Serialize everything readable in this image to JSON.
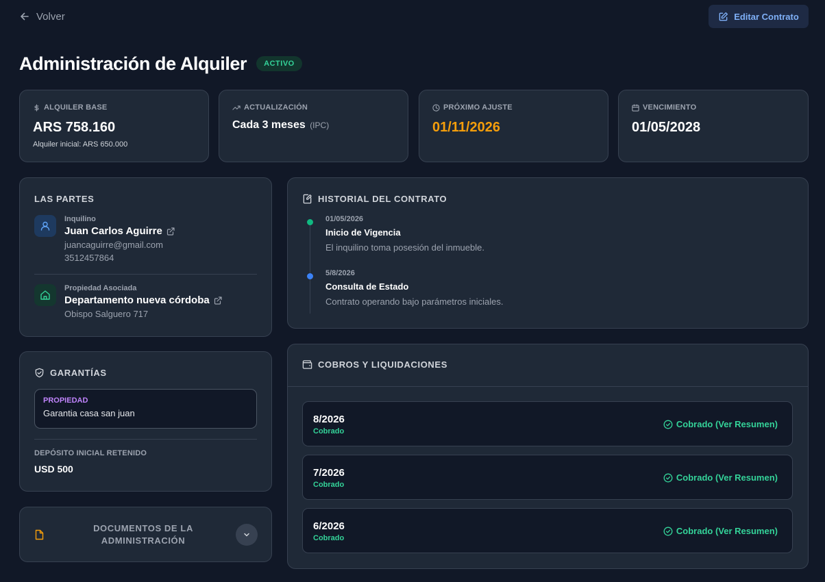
{
  "nav": {
    "back_label": "Volver",
    "edit_label": "Editar Contrato"
  },
  "header": {
    "title": "Administración de Alquiler",
    "status": "ACTIVO"
  },
  "stats": {
    "base_rent": {
      "label": "ALQUILER BASE",
      "value": "ARS 758.160",
      "note": "Alquiler inicial: ARS 650.000",
      "icon": "dollar-icon"
    },
    "update": {
      "label": "ACTUALIZACIÓN",
      "value": "Cada 3 meses",
      "value_suffix": "(IPC)",
      "icon": "trending-up-icon"
    },
    "next_adjust": {
      "label": "PRÓXIMO AJUSTE",
      "value": "01/11/2026",
      "icon": "clock-icon",
      "color": "#f59e0b"
    },
    "expiry": {
      "label": "VENCIMIENTO",
      "value": "01/05/2028",
      "icon": "calendar-icon"
    }
  },
  "parties": {
    "heading": "LAS PARTES",
    "tenant": {
      "role": "Inquilino",
      "name": "Juan Carlos Aguirre",
      "email": "juancaguirre@gmail.com",
      "phone": "3512457864"
    },
    "property": {
      "role": "Propiedad Asociada",
      "name": "Departamento nueva córdoba",
      "address": "Obispo Salguero 717"
    }
  },
  "guarantees": {
    "heading": "GARANTÍAS",
    "item": {
      "type": "PROPIEDAD",
      "description": "Garantia casa san juan"
    },
    "deposit_label": "DEPÓSITO INICIAL RETENIDO",
    "deposit_value": "USD 500"
  },
  "documents": {
    "heading_line1": "DOCUMENTOS DE LA",
    "heading_line2": "ADMINISTRACIÓN"
  },
  "history": {
    "heading": "HISTORIAL DEL CONTRATO",
    "events": [
      {
        "date": "01/05/2026",
        "title": "Inicio de Vigencia",
        "description": "El inquilino toma posesión del inmueble.",
        "color": "#10b981"
      },
      {
        "date": "5/8/2026",
        "title": "Consulta de Estado",
        "description": "Contrato operando bajo parámetros iniciales.",
        "color": "#3b82f6"
      }
    ]
  },
  "payments": {
    "heading": "COBROS Y LIQUIDACIONES",
    "rows": [
      {
        "period": "8/2026",
        "status": "Cobrado",
        "action": "Cobrado (Ver Resumen)"
      },
      {
        "period": "7/2026",
        "status": "Cobrado",
        "action": "Cobrado (Ver Resumen)"
      },
      {
        "period": "6/2026",
        "status": "Cobrado",
        "action": "Cobrado (Ver Resumen)"
      }
    ]
  },
  "colors": {
    "background": "#111827",
    "card": "#1f2937",
    "accent_green": "#34d399",
    "accent_blue": "#7fb0f7",
    "accent_orange": "#f59e0b",
    "accent_purple": "#c084fc"
  }
}
